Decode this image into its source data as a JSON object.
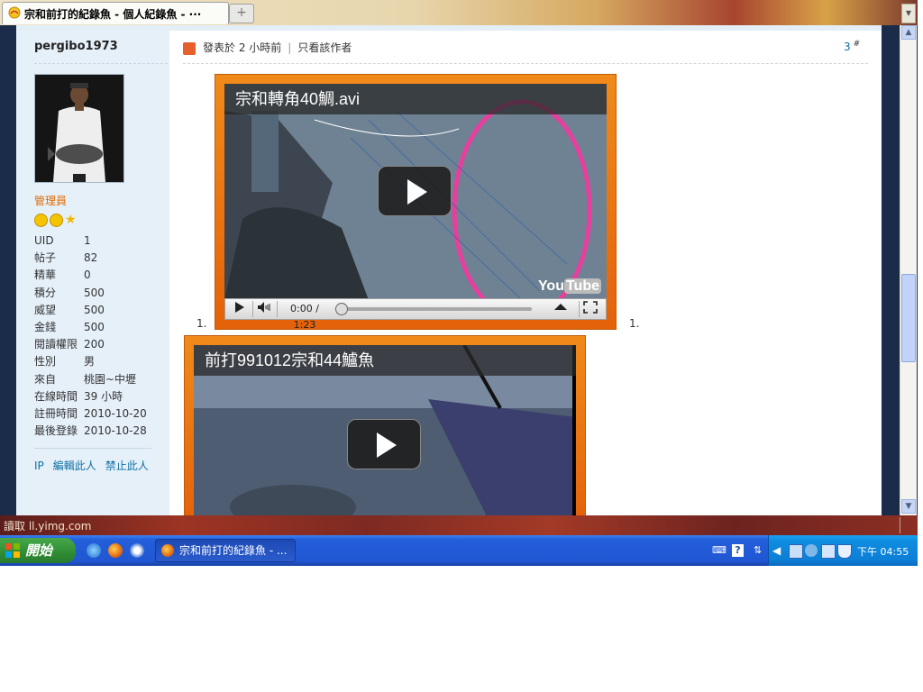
{
  "browser": {
    "tab_title": "宗和前打的紀錄魚 - 個人紀錄魚 - ···",
    "new_tab_symbol": "+",
    "scroll_symbol": "▼"
  },
  "author": {
    "name": "pergibo1973",
    "role": "管理員",
    "stats": [
      {
        "key": "UID",
        "value": "1"
      },
      {
        "key": "帖子",
        "value": "82"
      },
      {
        "key": "精華",
        "value": "0"
      },
      {
        "key": "積分",
        "value": "500"
      },
      {
        "key": "威望",
        "value": "500"
      },
      {
        "key": "金錢",
        "value": "500"
      },
      {
        "key": "閱讀權限",
        "value": "200"
      },
      {
        "key": "性別",
        "value": "男"
      },
      {
        "key": "來自",
        "value": "桃園~中壢"
      },
      {
        "key": "在線時間",
        "value": "39 小時"
      },
      {
        "key": "註冊時間",
        "value": "2010-10-20"
      },
      {
        "key": "最後登錄",
        "value": "2010-10-28"
      }
    ],
    "links": [
      "IP",
      "編輯此人",
      "禁止此人"
    ]
  },
  "post": {
    "posted": "發表於 2 小時前",
    "sep": "|",
    "only_author": "只看該作者",
    "floor": "3",
    "floor_mark": "#",
    "list_marker": "1."
  },
  "videos": [
    {
      "title": "宗和轉角40鯛.avi",
      "time": "0:00 / 1:23",
      "logo_you": "You",
      "logo_tube": "Tube"
    },
    {
      "title": "前打991012宗和44鱸魚"
    }
  ],
  "statusbar": {
    "text": "讀取 ll.yimg.com"
  },
  "taskbar": {
    "start_label": "開始",
    "task_label": "宗和前打的紀錄魚 - ...",
    "clock": "下午 04:55"
  },
  "colors": {
    "accent_orange": "#e4620a",
    "link_blue": "#0d6fa3",
    "taskbar_blue": "#245edb",
    "start_green": "#2f8c33"
  },
  "icons": [
    "firefox-icon",
    "ie-icon",
    "media-player-icon",
    "play-icon",
    "volume-icon",
    "fullscreen-icon",
    "youtube-logo",
    "help-icon",
    "keyboard-icon",
    "network-icon",
    "shield-icon"
  ]
}
